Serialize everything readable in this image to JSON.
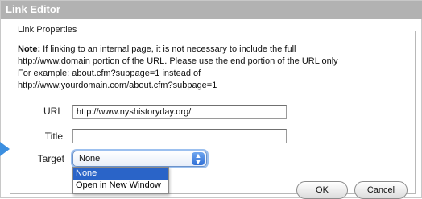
{
  "dialog": {
    "title": "Link Editor",
    "legend": "Link Properties"
  },
  "note": {
    "label": "Note:",
    "line1": " If linking to an internal page, it is not necessary to include the full",
    "line2": "http://www.domain portion of the URL. Please use the end portion of the URL only",
    "line3": "For example: about.cfm?subpage=1 instead of",
    "line4": "http://www.yourdomain.com/about.cfm?subpage=1"
  },
  "form": {
    "url_label": "URL",
    "url_value": "http://www.nyshistoryday.org/",
    "title_label": "Title",
    "title_value": "",
    "target_label": "Target",
    "target_value": "None",
    "target_options": [
      "None",
      "Open in New Window"
    ]
  },
  "buttons": {
    "ok": "OK",
    "cancel": "Cancel"
  },
  "icons": {
    "select_arrows": "updown-arrows-icon",
    "pointer": "arrow-pointer-icon"
  },
  "colors": {
    "titlebar": "#b2b2b2",
    "selection": "#2a64c8",
    "pointer": "#3c8fe0"
  }
}
